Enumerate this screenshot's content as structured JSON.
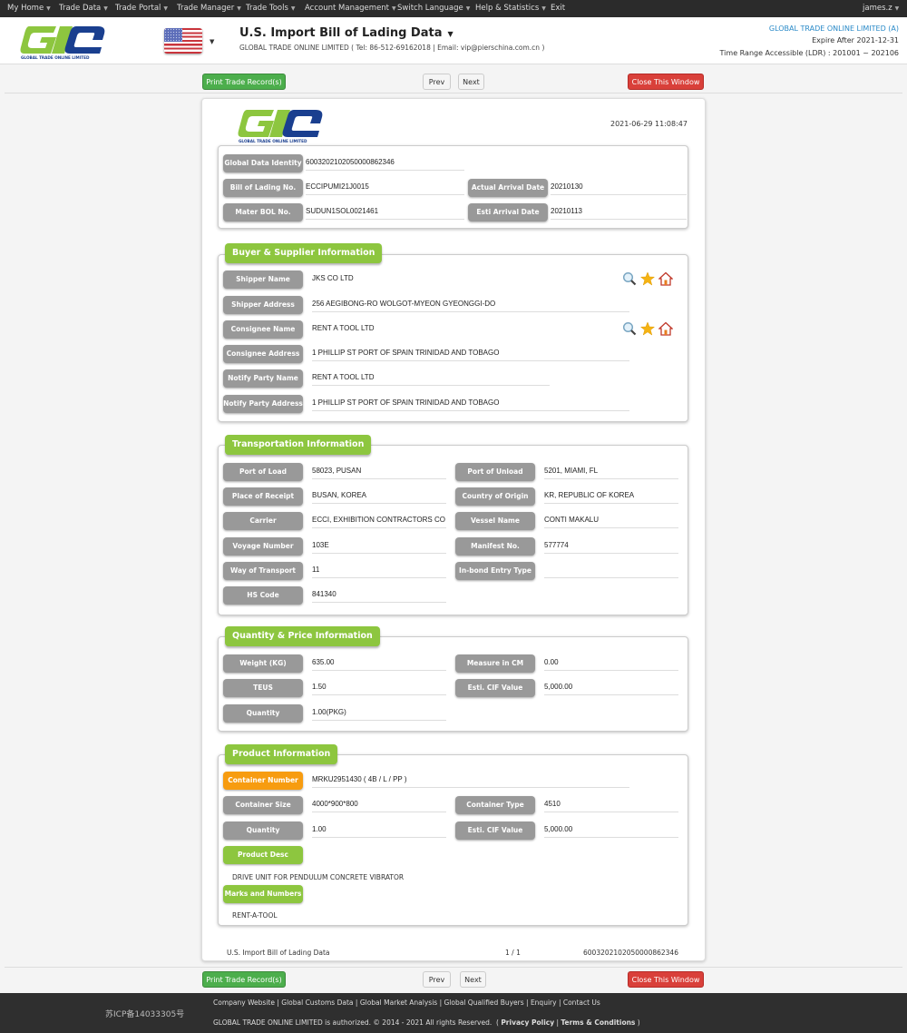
{
  "nav": {
    "items": [
      {
        "label": "My Home",
        "caret": true
      },
      {
        "label": "Trade Data",
        "caret": true
      },
      {
        "label": "Trade Portal",
        "caret": true
      },
      {
        "label": "Trade Manager",
        "caret": true
      },
      {
        "label": "Trade Tools",
        "caret": true
      },
      {
        "label": "Account Management",
        "caret": true
      },
      {
        "label": "Switch Language",
        "caret": true
      },
      {
        "label": "Help & Statistics",
        "caret": true
      },
      {
        "label": "Exit",
        "caret": false
      }
    ],
    "user": "james.z"
  },
  "header": {
    "logo_text": "GLOBAL TRADE ONLINE LIMITED",
    "title": "U.S. Import Bill of Lading Data",
    "subtitle": "GLOBAL TRADE ONLINE LIMITED ( Tel: 86-512-69162018 | Email: vip@pierschina.com.cn )",
    "company": "GLOBAL TRADE ONLINE LIMITED (A)",
    "expire": "Expire After 2021-12-31",
    "time_range": "Time Range Accessible (LDR) : 201001 ~ 202106",
    "company_color": "#2a8ac8"
  },
  "toolbar": {
    "print_label": "Print Trade Record(s)",
    "prev_label": "Prev",
    "next_label": "Next",
    "close_label": "Close This Window"
  },
  "record": {
    "timestamp": "2021-06-29 11:08:47",
    "identity": {
      "global_data_identity": {
        "label": "Global Data Identity",
        "value": "6003202102050000862346"
      },
      "bill_of_lading_no": {
        "label": "Bill of Lading No.",
        "value": "ECCIPUMI21J0015"
      },
      "actual_arrival_date": {
        "label": "Actual Arrival Date",
        "value": "20210130"
      },
      "mater_bol_no": {
        "label": "Mater BOL No.",
        "value": "SUDUN1SOL0021461"
      },
      "esti_arrival_date": {
        "label": "Esti Arrival Date",
        "value": "20210113"
      }
    },
    "buyer_supplier": {
      "title": "Buyer & Supplier Information",
      "shipper_name": {
        "label": "Shipper Name",
        "value": "JKS CO LTD"
      },
      "shipper_address": {
        "label": "Shipper Address",
        "value": "256 AEGIBONG-RO WOLGOT-MYEON GYEONGGI-DO"
      },
      "consignee_name": {
        "label": "Consignee Name",
        "value": "RENT A TOOL LTD"
      },
      "consignee_address": {
        "label": "Consignee Address",
        "value": "1 PHILLIP ST PORT OF SPAIN TRINIDAD AND TOBAGO"
      },
      "notify_party_name": {
        "label": "Notify Party Name",
        "value": "RENT A TOOL LTD"
      },
      "notify_party_address": {
        "label": "Notify Party Address",
        "value": "1 PHILLIP ST PORT OF SPAIN TRINIDAD AND TOBAGO"
      }
    },
    "transportation": {
      "title": "Transportation Information",
      "port_of_load": {
        "label": "Port of Load",
        "value": "58023, PUSAN"
      },
      "port_of_unload": {
        "label": "Port of Unload",
        "value": "5201, MIAMI, FL"
      },
      "place_of_receipt": {
        "label": "Place of Receipt",
        "value": "BUSAN, KOREA"
      },
      "country_of_origin": {
        "label": "Country of Origin",
        "value": "KR, REPUBLIC OF KOREA"
      },
      "carrier": {
        "label": "Carrier",
        "value": "ECCI, EXHIBITION CONTRACTORS CO"
      },
      "vessel_name": {
        "label": "Vessel Name",
        "value": "CONTI MAKALU"
      },
      "voyage_number": {
        "label": "Voyage Number",
        "value": "103E"
      },
      "manifest_no": {
        "label": "Manifest No.",
        "value": "577774"
      },
      "way_of_transport": {
        "label": "Way of Transport",
        "value": "11"
      },
      "inbond_entry_type": {
        "label": "In-bond Entry Type",
        "value": ""
      },
      "hs_code": {
        "label": "HS Code",
        "value": "841340"
      }
    },
    "quantity_price": {
      "title": "Quantity & Price Information",
      "weight": {
        "label": "Weight (KG)",
        "value": "635.00"
      },
      "measure": {
        "label": "Measure in CM",
        "value": "0.00"
      },
      "teus": {
        "label": "TEUS",
        "value": "1.50"
      },
      "cif_value": {
        "label": "Esti. CIF Value",
        "value": "5,000.00"
      },
      "quantity": {
        "label": "Quantity",
        "value": "1.00(PKG)"
      }
    },
    "product": {
      "title": "Product Information",
      "container_number": {
        "label": "Container Number",
        "value": "MRKU2951430 ( 4B / L / PP )"
      },
      "container_size": {
        "label": "Container Size",
        "value": "4000*900*800"
      },
      "container_type": {
        "label": "Container Type",
        "value": "4510"
      },
      "quantity": {
        "label": "Quantity",
        "value": "1.00"
      },
      "cif_value": {
        "label": "Esti. CIF Value",
        "value": "5,000.00"
      },
      "product_desc": {
        "label": "Product Desc",
        "value": "DRIVE UNIT FOR PENDULUM CONCRETE VIBRATOR"
      },
      "marks_numbers": {
        "label": "Marks and Numbers",
        "value": "RENT-A-TOOL"
      }
    },
    "footer": {
      "doc_name": "U.S. Import Bill of Lading Data",
      "page": "1 / 1",
      "id": "6003202102050000862346"
    }
  },
  "footer": {
    "icp": "苏ICP备14033305号",
    "links": [
      "Company Website",
      "Global Customs Data",
      "Global Market Analysis",
      "Global Qualified Buyers",
      "Enquiry",
      "Contact Us"
    ],
    "copyright": "GLOBAL TRADE ONLINE LIMITED is authorized. © 2014 - 2021 All rights Reserved.",
    "policy_links": [
      "Privacy Policy",
      "Terms & Conditions"
    ]
  }
}
